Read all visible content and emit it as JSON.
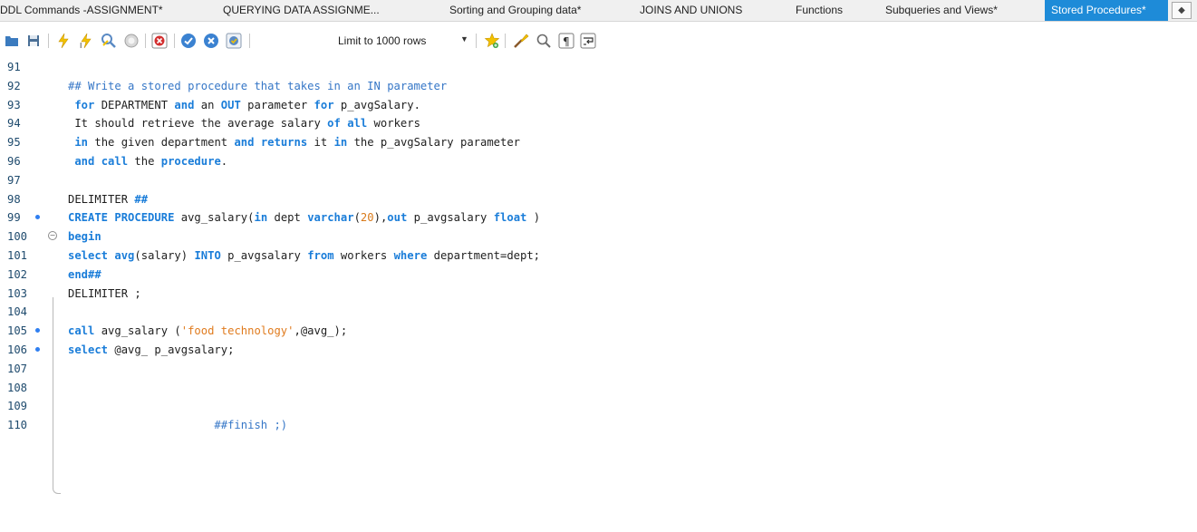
{
  "tabs": [
    {
      "label": "DDL Commands -ASSIGNMENT*",
      "active": false
    },
    {
      "label": "QUERYING  DATA  ASSIGNME...",
      "active": false
    },
    {
      "label": "Sorting and Grouping data*",
      "active": false
    },
    {
      "label": "JOINS AND UNIONS",
      "active": false
    },
    {
      "label": "Functions",
      "active": false
    },
    {
      "label": "Subqueries and Views*",
      "active": false
    },
    {
      "label": "Stored Procedures*",
      "active": true
    }
  ],
  "tab_scroll_icon": "◆",
  "toolbar": {
    "limit_label": "Limit to 1000 rows",
    "limit_arrow": "▼",
    "icons": [
      "open-file-icon",
      "save-icon",
      "execute-icon",
      "execute-current-icon",
      "explain-icon",
      "stop-icon",
      "toggle-error-icon",
      "commit-icon",
      "rollback-icon",
      "autocommit-icon",
      "limit-dropdown",
      "bookmark-icon",
      "beautify-icon",
      "find-icon",
      "invisible-chars-icon",
      "word-wrap-icon"
    ]
  },
  "editor": {
    "lines": [
      {
        "n": "91",
        "marker": false,
        "text": ""
      },
      {
        "n": "92",
        "marker": false,
        "text": "## Write a stored procedure that takes in an IN parameter"
      },
      {
        "n": "93",
        "marker": false,
        "text": " for DEPARTMENT and an OUT parameter for p_avgSalary."
      },
      {
        "n": "94",
        "marker": false,
        "text": " It should retrieve the average salary of all workers"
      },
      {
        "n": "95",
        "marker": false,
        "text": " in the given department and returns it in the p_avgSalary parameter"
      },
      {
        "n": "96",
        "marker": false,
        "text": " and call the procedure."
      },
      {
        "n": "97",
        "marker": false,
        "text": ""
      },
      {
        "n": "98",
        "marker": false,
        "text": "DELIMITER ##"
      },
      {
        "n": "99",
        "marker": true,
        "text": "CREATE PROCEDURE avg_salary(in dept varchar(20),out p_avgsalary float )"
      },
      {
        "n": "100",
        "marker": false,
        "text": "begin"
      },
      {
        "n": "101",
        "marker": false,
        "text": "select avg(salary) INTO p_avgsalary from workers where department=dept;"
      },
      {
        "n": "102",
        "marker": false,
        "text": "end##"
      },
      {
        "n": "103",
        "marker": false,
        "text": "DELIMITER ;"
      },
      {
        "n": "104",
        "marker": false,
        "text": ""
      },
      {
        "n": "105",
        "marker": true,
        "text": "call avg_salary ('food technology',@avg_);"
      },
      {
        "n": "106",
        "marker": true,
        "text": "select @avg_ p_avgsalary;"
      },
      {
        "n": "107",
        "marker": false,
        "text": ""
      },
      {
        "n": "108",
        "marker": false,
        "text": ""
      },
      {
        "n": "109",
        "marker": false,
        "text": ""
      },
      {
        "n": "110",
        "marker": false,
        "text": "                      ##finish ;)"
      }
    ],
    "fold_symbol": "−"
  }
}
